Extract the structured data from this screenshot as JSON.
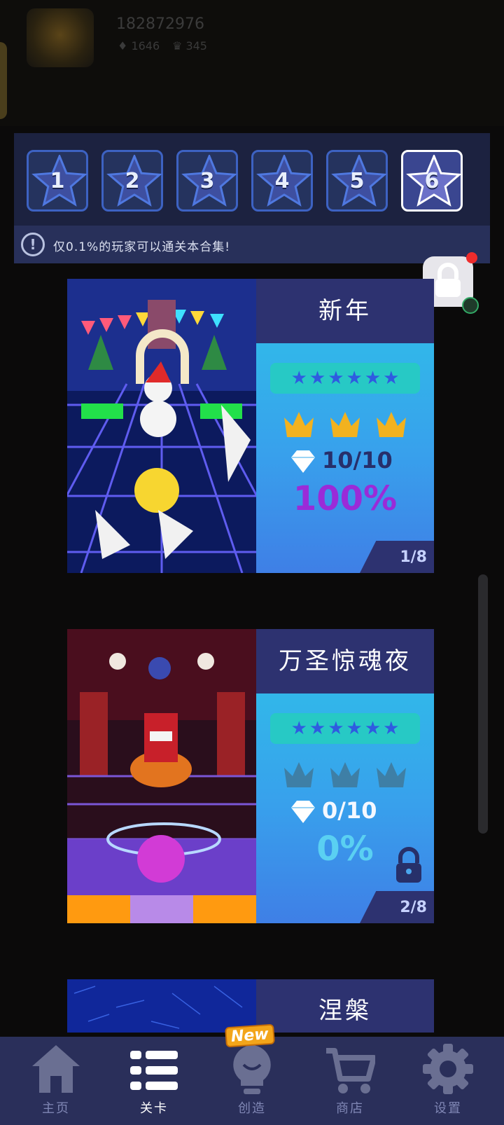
{
  "profile": {
    "player_id": "182872976",
    "gems": "1646",
    "crowns": "345"
  },
  "star_tabs": [
    {
      "label": "1",
      "selected": false
    },
    {
      "label": "2",
      "selected": false
    },
    {
      "label": "3",
      "selected": false
    },
    {
      "label": "4",
      "selected": false
    },
    {
      "label": "5",
      "selected": false
    },
    {
      "label": "6",
      "selected": true
    }
  ],
  "notice": {
    "text": "仅0.1%的玩家可以通关本合集!"
  },
  "levels": [
    {
      "title": "新年",
      "stars": 6,
      "crowns_earned": 3,
      "gems": "10/10",
      "percent": "100%",
      "page": "1/8",
      "locked": false,
      "percent_color": "#9a2bd8"
    },
    {
      "title": "万圣惊魂夜",
      "stars": 6,
      "crowns_earned": 0,
      "gems": "0/10",
      "percent": "0%",
      "page": "2/8",
      "locked": true,
      "percent_color": "#5ad0f2"
    },
    {
      "title": "涅槃"
    }
  ],
  "nav": {
    "home": "主页",
    "levels": "关卡",
    "create": "创造",
    "shop": "商店",
    "settings": "设置",
    "new_badge": "New",
    "active": "levels"
  },
  "colors": {
    "accent": "#2d3270",
    "panel": "#1c2240",
    "crown_gold": "#f2b21f",
    "crown_locked": "#3e7fa6"
  }
}
